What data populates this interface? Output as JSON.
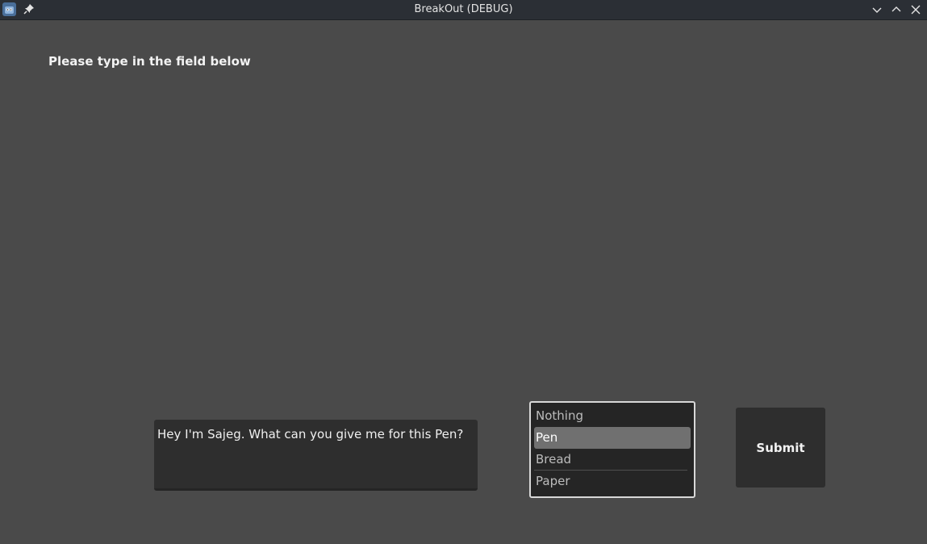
{
  "window": {
    "title": "BreakOut (DEBUG)",
    "icons": [
      "godot-engine-icon",
      "pin-icon",
      "minimize-icon",
      "maximize-icon",
      "close-icon"
    ]
  },
  "main": {
    "prompt": "Please type in the field below",
    "input_value": "Hey I'm Sajeg. What can you give me for this Pen?",
    "items": [
      "Nothing",
      "Pen",
      "Bread",
      "Paper"
    ],
    "selected_item": "Pen",
    "submit_label": "Submit"
  },
  "colors": {
    "background": "#4a4a4a",
    "titlebar": "#2b2f35",
    "panel": "#2e2e2e",
    "selection": "#707070"
  }
}
